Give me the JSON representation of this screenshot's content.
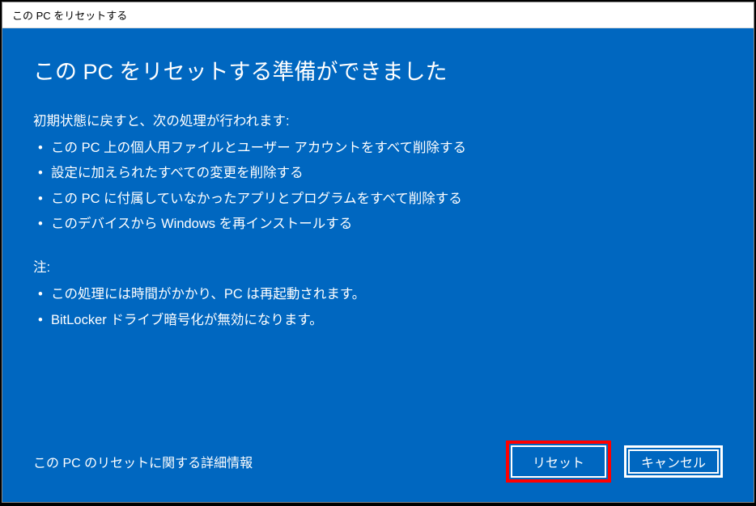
{
  "titleBar": "この PC をリセットする",
  "heading": "この PC をリセットする準備ができました",
  "intro": "初期状態に戻すと、次の処理が行われます:",
  "bullets": [
    "この PC 上の個人用ファイルとユーザー アカウントをすべて削除する",
    "設定に加えられたすべての変更を削除する",
    "この PC に付属していなかったアプリとプログラムをすべて削除する",
    "このデバイスから Windows を再インストールする"
  ],
  "noteLabel": "注:",
  "noteBullets": [
    "この処理には時間がかかり、PC は再起動されます。",
    "BitLocker ドライブ暗号化が無効になります。"
  ],
  "moreInfo": "この PC のリセットに関する詳細情報",
  "buttons": {
    "reset": "リセット",
    "cancel": "キャンセル"
  }
}
